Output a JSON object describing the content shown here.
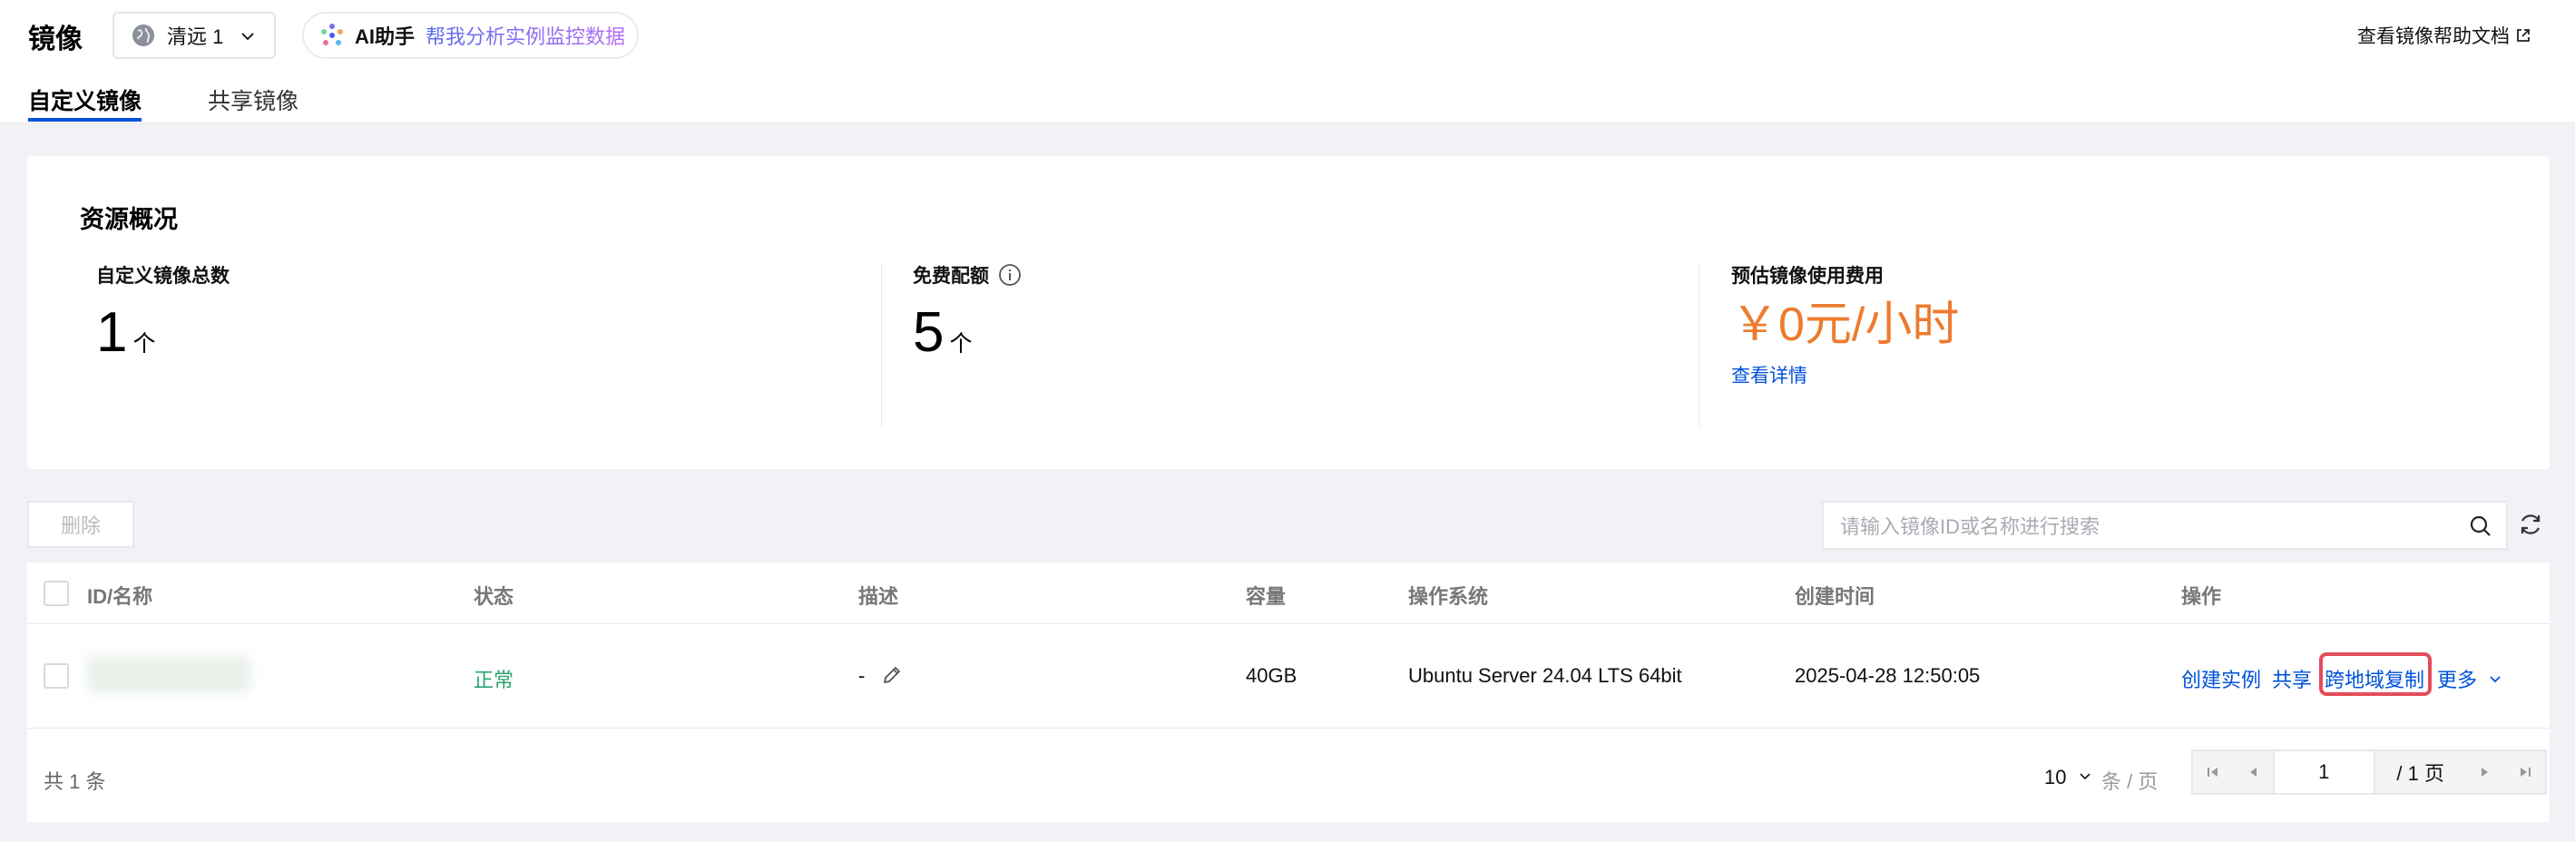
{
  "header": {
    "title": "镜像",
    "region_label": "清远 1",
    "ai_label": "AI助手",
    "ai_prompt": "帮我分析实例监控数据",
    "help_link": "查看镜像帮助文档"
  },
  "tabs": [
    {
      "label": "自定义镜像",
      "active": true
    },
    {
      "label": "共享镜像",
      "active": false
    }
  ],
  "overview": {
    "title": "资源概况",
    "stats": [
      {
        "label": "自定义镜像总数",
        "value": "1",
        "unit": "个"
      },
      {
        "label": "免费配额",
        "value": "5",
        "unit": "个"
      },
      {
        "label": "预估镜像使用费用",
        "value": "￥0元/小时",
        "link": "查看详情"
      }
    ]
  },
  "toolbar": {
    "delete_label": "删除",
    "search_placeholder": "请输入镜像ID或名称进行搜索"
  },
  "table": {
    "columns": [
      "ID/名称",
      "状态",
      "描述",
      "容量",
      "操作系统",
      "创建时间",
      "操作"
    ],
    "rows": [
      {
        "id_name": "",
        "status": "正常",
        "description": "-",
        "capacity": "40GB",
        "os": "Ubuntu Server 24.04 LTS 64bit",
        "created": "2025-04-28 12:50:05",
        "actions": [
          "创建实例",
          "共享",
          "跨地域复制",
          "更多"
        ]
      }
    ]
  },
  "footer": {
    "total": "共 1 条",
    "page_size": "10",
    "per_page_label": "条 / 页",
    "current_page": "1",
    "total_pages": "/ 1 页"
  },
  "colors": {
    "primary": "#0052d9",
    "status_ok": "#2ba471",
    "cost": "#ed7b2f",
    "highlight": "#e34d59"
  }
}
